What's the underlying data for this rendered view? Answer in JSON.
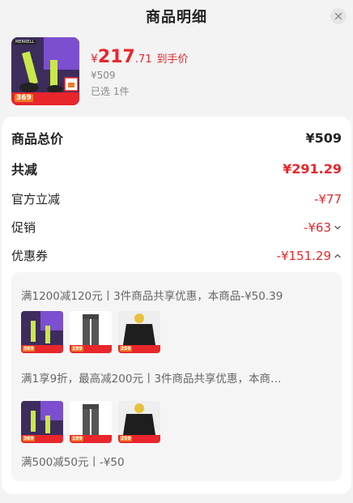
{
  "header": {
    "title": "商品明细"
  },
  "product": {
    "currency": "¥",
    "price_int": "217",
    "price_dec": ".71",
    "price_suffix": "到手价",
    "original_price": "¥509",
    "selected_count": "已选 1件",
    "thumb_badge": "369",
    "thumb_brand": "MERRELL"
  },
  "summary": {
    "total_label": "商品总价",
    "total_value": "¥509",
    "discount_label": "共减",
    "discount_value": "¥291.29",
    "official_label": "官方立减",
    "official_value": "-¥77",
    "promo_label": "促销",
    "promo_value": "-¥63",
    "coupon_label": "优惠券",
    "coupon_value": "-¥151.29"
  },
  "coupons": [
    {
      "text": "满1200减120元丨3件商品共享优惠，本商品-¥50.39",
      "badges": [
        "369",
        "199",
        "259"
      ]
    },
    {
      "text": "满1享9折，最高减200元丨3件商品共享优惠，本商…",
      "badges": [
        "369",
        "199",
        "259"
      ]
    },
    {
      "text": "满500减50元丨-¥50"
    }
  ],
  "colors": {
    "accent": "#e8262b",
    "background": "#f3f3f3",
    "card": "#ffffff"
  }
}
